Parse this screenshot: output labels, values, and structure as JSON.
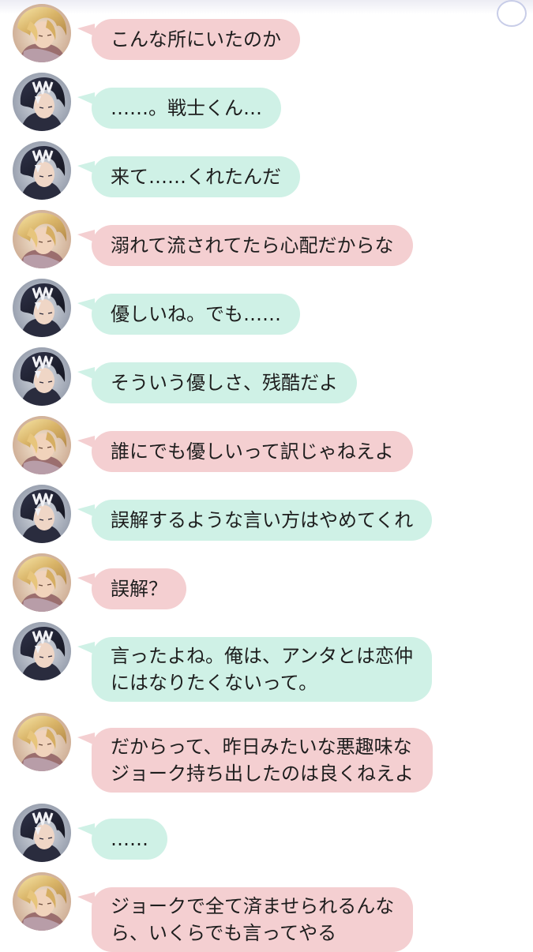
{
  "messages": [
    {
      "speaker": "blonde",
      "color": "pink",
      "lines": [
        "こんな所にいたのか"
      ]
    },
    {
      "speaker": "dark",
      "color": "mint",
      "lines": [
        "……。戦士くん…"
      ]
    },
    {
      "speaker": "dark",
      "color": "mint",
      "lines": [
        "来て……くれたんだ"
      ]
    },
    {
      "speaker": "blonde",
      "color": "pink",
      "lines": [
        "溺れて流されてたら心配だからな"
      ]
    },
    {
      "speaker": "dark",
      "color": "mint",
      "lines": [
        "優しいね。でも……"
      ]
    },
    {
      "speaker": "dark",
      "color": "mint",
      "lines": [
        "そういう優しさ、残酷だよ"
      ]
    },
    {
      "speaker": "blonde",
      "color": "pink",
      "lines": [
        "誰にでも優しいって訳じゃねえよ"
      ]
    },
    {
      "speaker": "dark",
      "color": "mint",
      "lines": [
        "誤解するような言い方はやめてくれ"
      ]
    },
    {
      "speaker": "blonde",
      "color": "pink",
      "lines": [
        "誤解？"
      ]
    },
    {
      "speaker": "dark",
      "color": "mint",
      "lines": [
        "言ったよね。俺は、アンタとは恋仲",
        "にはなりたくないって。"
      ]
    },
    {
      "speaker": "blonde",
      "color": "pink",
      "lines": [
        "だからって、昨日みたいな悪趣味な",
        "ジョーク持ち出したのは良くねえよ"
      ]
    },
    {
      "speaker": "dark",
      "color": "mint",
      "lines": [
        "……"
      ]
    },
    {
      "speaker": "blonde",
      "color": "pink",
      "lines": [
        "ジョークで全て済ませられるんな",
        "ら、いくらでも言ってやる"
      ]
    }
  ],
  "colors": {
    "pink_bubble": "#f4cfd1",
    "mint_bubble": "#cff1e6",
    "text": "#1e1e1e"
  },
  "icons": {
    "blonde": "blonde-character-avatar-icon",
    "dark": "dark-haired-character-avatar-icon"
  }
}
